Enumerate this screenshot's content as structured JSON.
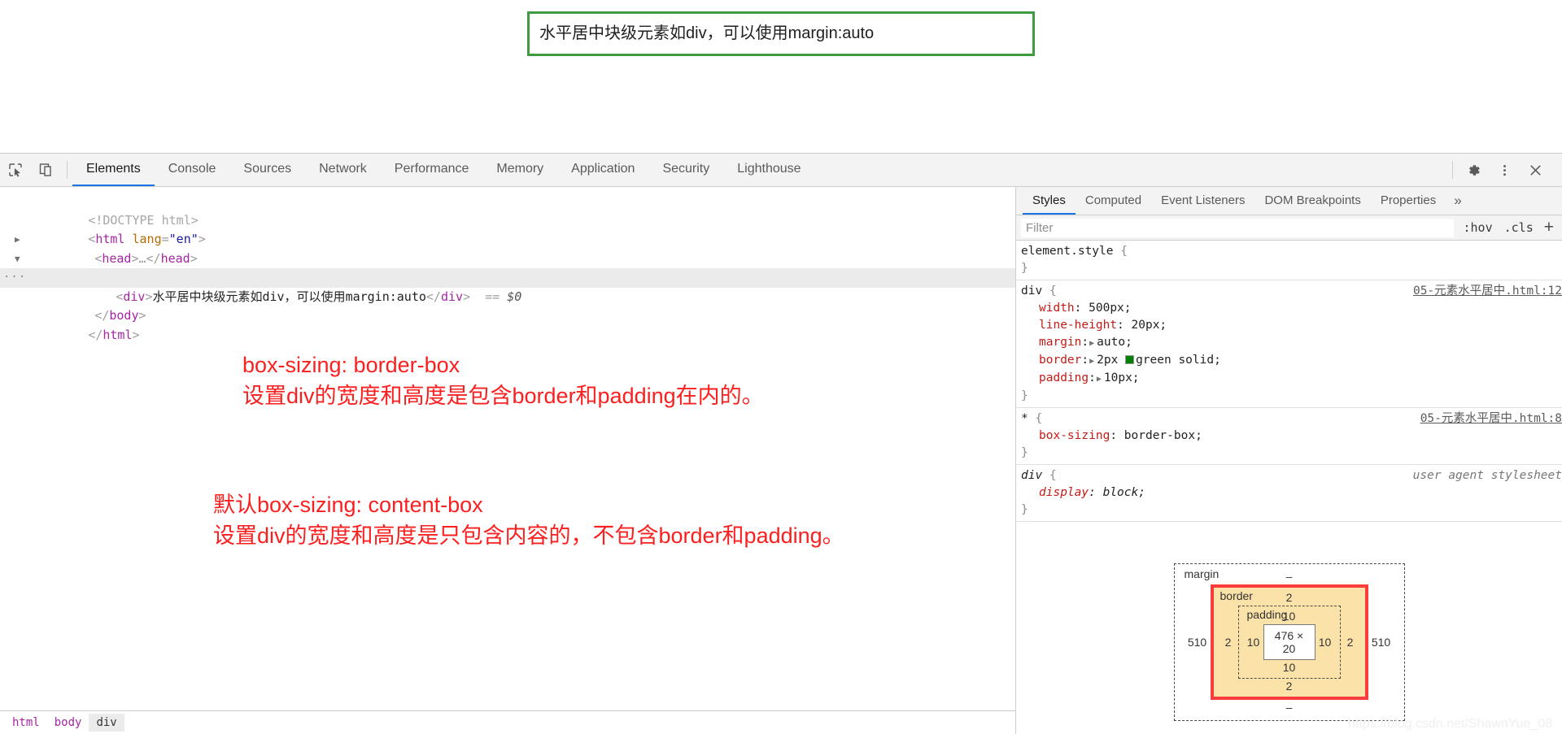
{
  "page": {
    "centered_div_text": "水平居中块级元素如div，可以使用margin:auto",
    "border_color": "#3f9b3f"
  },
  "annotations": [
    {
      "id": "annot-1",
      "line1": "box-sizing: border-box",
      "line2": "设置div的宽度和高度是包含border和padding在内的。",
      "color": "#fa2020"
    },
    {
      "id": "annot-2",
      "line1": "默认box-sizing: content-box",
      "line2": "设置div的宽度和高度是只包含内容的，不包含border和padding。",
      "color": "#fa2020"
    }
  ],
  "devtools": {
    "toolbar": {
      "inspect_icon": "inspect-element-icon",
      "device_icon": "device-toolbar-icon",
      "tabs": [
        {
          "label": "Elements",
          "active": true
        },
        {
          "label": "Console",
          "active": false
        },
        {
          "label": "Sources",
          "active": false
        },
        {
          "label": "Network",
          "active": false
        },
        {
          "label": "Performance",
          "active": false
        },
        {
          "label": "Memory",
          "active": false
        },
        {
          "label": "Application",
          "active": false
        },
        {
          "label": "Security",
          "active": false
        },
        {
          "label": "Lighthouse",
          "active": false
        }
      ],
      "right_icons": [
        "gear-icon",
        "more-vertical-icon",
        "close-icon"
      ]
    },
    "dom_tree": [
      {
        "indent": 1,
        "tri": "",
        "segments": [
          {
            "t": "doctype",
            "s": "<!DOCTYPE html>"
          }
        ]
      },
      {
        "indent": 1,
        "tri": "",
        "segments": [
          {
            "t": "punct",
            "s": "<"
          },
          {
            "t": "tag",
            "s": "html"
          },
          {
            "t": "sp",
            "s": " "
          },
          {
            "t": "attr",
            "s": "lang"
          },
          {
            "t": "punct",
            "s": "="
          },
          {
            "t": "val",
            "s": "\"en\""
          },
          {
            "t": "punct",
            "s": ">"
          }
        ]
      },
      {
        "indent": 2,
        "tri": "r",
        "segments": [
          {
            "t": "punct",
            "s": "<"
          },
          {
            "t": "tag",
            "s": "head"
          },
          {
            "t": "punct",
            "s": ">"
          },
          {
            "t": "punct",
            "s": "…"
          },
          {
            "t": "punct",
            "s": "</"
          },
          {
            "t": "tag",
            "s": "head"
          },
          {
            "t": "punct",
            "s": ">"
          }
        ]
      },
      {
        "indent": 2,
        "tri": "d",
        "segments": [
          {
            "t": "punct",
            "s": "<"
          },
          {
            "t": "tag",
            "s": "body"
          },
          {
            "t": "punct",
            "s": ">"
          }
        ]
      },
      {
        "indent": 3,
        "tri": "",
        "selected": true,
        "badge": "···",
        "segments": [
          {
            "t": "punct",
            "s": "<"
          },
          {
            "t": "tag",
            "s": "div"
          },
          {
            "t": "punct",
            "s": ">"
          },
          {
            "t": "text",
            "s": "水平居中块级元素如div，可以使用margin:auto"
          },
          {
            "t": "punct",
            "s": "</"
          },
          {
            "t": "tag",
            "s": "div"
          },
          {
            "t": "punct",
            "s": ">"
          },
          {
            "t": "sp",
            "s": "  "
          },
          {
            "t": "punct",
            "s": "=="
          },
          {
            "t": "sp",
            "s": " "
          },
          {
            "t": "dollar",
            "s": "$0"
          }
        ]
      },
      {
        "indent": 2,
        "tri": "",
        "segments": [
          {
            "t": "punct",
            "s": "</"
          },
          {
            "t": "tag",
            "s": "body"
          },
          {
            "t": "punct",
            "s": ">"
          }
        ]
      },
      {
        "indent": 1,
        "tri": "",
        "segments": [
          {
            "t": "punct",
            "s": "</"
          },
          {
            "t": "tag",
            "s": "html"
          },
          {
            "t": "punct",
            "s": ">"
          }
        ]
      }
    ],
    "breadcrumb": [
      {
        "label": "html",
        "active": false
      },
      {
        "label": "body",
        "active": false
      },
      {
        "label": "div",
        "active": true
      }
    ],
    "styles": {
      "tabs": [
        {
          "label": "Styles",
          "active": true
        },
        {
          "label": "Computed",
          "active": false
        },
        {
          "label": "Event Listeners",
          "active": false
        },
        {
          "label": "DOM Breakpoints",
          "active": false
        },
        {
          "label": "Properties",
          "active": false
        }
      ],
      "more_label": "»",
      "filter_placeholder": "Filter",
      "filter_value": "",
      "hov_label": ":hov",
      "cls_label": ".cls",
      "plus_label": "+",
      "rules": [
        {
          "selector": "element.style",
          "origin": "",
          "origin_kind": "none",
          "declarations": []
        },
        {
          "selector": "div",
          "origin": "05-元素水平居中.html:12",
          "origin_kind": "link",
          "declarations": [
            {
              "prop": "width",
              "value": "500px",
              "arrow": false,
              "swatch": false
            },
            {
              "prop": "line-height",
              "value": "20px",
              "arrow": false,
              "swatch": false
            },
            {
              "prop": "margin",
              "value": "auto",
              "arrow": true,
              "swatch": false
            },
            {
              "prop": "border",
              "value": "2px green solid",
              "arrow": true,
              "swatch": true,
              "swatch_color": "#008000"
            },
            {
              "prop": "padding",
              "value": "10px",
              "arrow": true,
              "swatch": false
            }
          ]
        },
        {
          "selector": "*",
          "origin": "05-元素水平居中.html:8",
          "origin_kind": "link",
          "declarations": [
            {
              "prop": "box-sizing",
              "value": "border-box",
              "arrow": false,
              "swatch": false
            }
          ]
        },
        {
          "selector": "div",
          "origin": "user agent stylesheet",
          "origin_kind": "ua",
          "italic": true,
          "declarations": [
            {
              "prop": "display",
              "value": "block",
              "arrow": false,
              "swatch": false
            }
          ]
        }
      ]
    },
    "box_model": {
      "margin_label": "margin",
      "margin_top": "–",
      "margin_bottom": "–",
      "margin_left": "510",
      "margin_right": "510",
      "border_label": "border",
      "border_top": "2",
      "border_bottom": "2",
      "border_left": "2",
      "border_right": "2",
      "padding_label": "padding",
      "padding_top": "10",
      "padding_bottom": "10",
      "padding_left": "10",
      "padding_right": "10",
      "content_size": "476 × 20",
      "border_color": "#fa3c3c",
      "fill_color": "#fbe2a8"
    },
    "watermark": "https://blog.csdn.net/ShawnYue_08"
  }
}
